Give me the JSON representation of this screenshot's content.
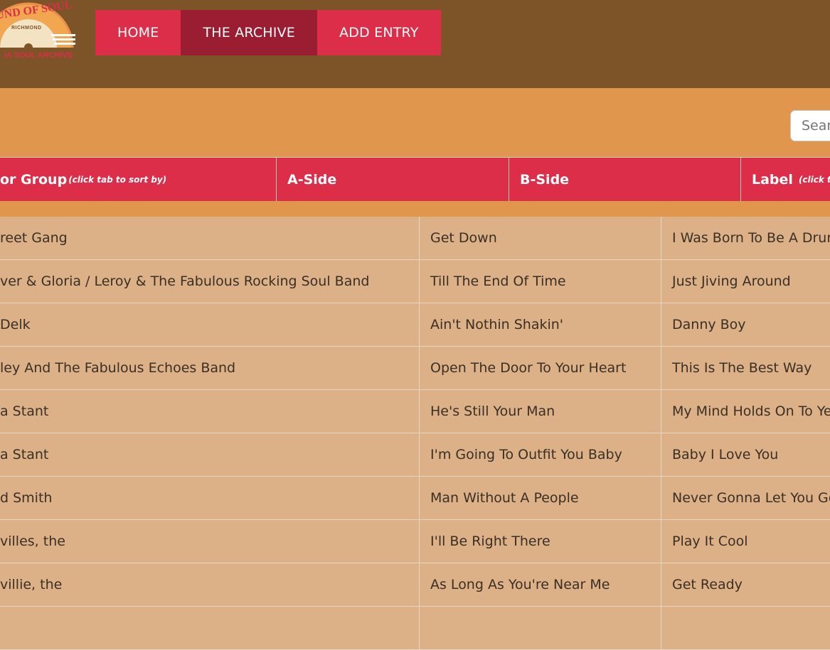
{
  "header": {
    "logo": {
      "top_text": "UND OF SOUL",
      "middle_text": "RICHMOND",
      "bottom_text": "IA SOUL ARCHIVE"
    },
    "nav": [
      {
        "label": "HOME",
        "active": false
      },
      {
        "label": "THE ARCHIVE",
        "active": true
      },
      {
        "label": "ADD ENTRY",
        "active": false
      }
    ]
  },
  "search": {
    "placeholder": "Search"
  },
  "table": {
    "columns": [
      {
        "label": "or Group",
        "hint": "(click tab to sort by)"
      },
      {
        "label": "A-Side",
        "hint": ""
      },
      {
        "label": "B-Side",
        "hint": ""
      },
      {
        "label": "Label",
        "hint": "(click tab"
      }
    ],
    "rows": [
      {
        "artist": "reet Gang",
        "a_side": "Get Down",
        "b_side": "I Was Born To Be A Drumm"
      },
      {
        "artist": "ver & Gloria / Leroy & The Fabulous Rocking Soul Band",
        "a_side": "Till The End Of Time",
        "b_side": "Just Jiving Around"
      },
      {
        "artist": "Delk",
        "a_side": "Ain't Nothin Shakin'",
        "b_side": "Danny Boy"
      },
      {
        "artist": "ley And The Fabulous Echoes Band",
        "a_side": "Open The Door To Your Heart",
        "b_side": "This Is The Best Way"
      },
      {
        "artist": "a Stant",
        "a_side": "He's Still Your Man",
        "b_side": "My Mind Holds On To Yes"
      },
      {
        "artist": "a Stant",
        "a_side": "I'm Going To Outfit You Baby",
        "b_side": "Baby I Love You"
      },
      {
        "artist": "d Smith",
        "a_side": "Man Without A People",
        "b_side": "Never Gonna Let You Go"
      },
      {
        "artist": "villes, the",
        "a_side": "I'll Be Right There",
        "b_side": "Play It Cool"
      },
      {
        "artist": "villie, the",
        "a_side": "As Long As You're Near Me",
        "b_side": "Get Ready"
      },
      {
        "artist": "",
        "a_side": "",
        "b_side": ""
      }
    ]
  },
  "colors": {
    "topbar": "#7c5428",
    "accent": "#dc2e49",
    "accent_active": "#9a1d31",
    "band": "#e0964d",
    "table_bg": "#dcb187"
  }
}
